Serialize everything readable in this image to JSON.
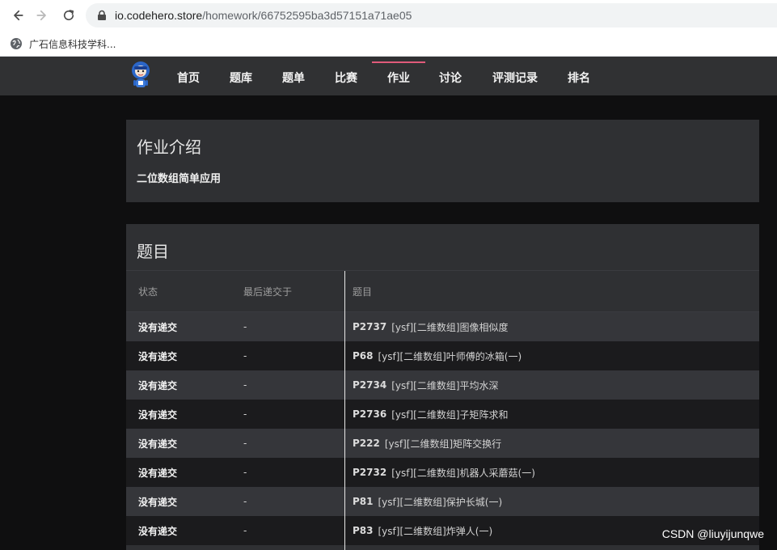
{
  "browser": {
    "url_domain": "io.codehero.store",
    "url_path": "/homework/66752595ba3d57151a71ae05",
    "bookmark_label": "广石信息科技学科..."
  },
  "site_nav": {
    "items": [
      "首页",
      "题库",
      "题单",
      "比赛",
      "作业",
      "讨论",
      "评测记录",
      "排名"
    ],
    "active": "作业"
  },
  "intro": {
    "title": "作业介绍",
    "text": "二位数组简单应用"
  },
  "problems": {
    "title": "题目",
    "columns": [
      "状态",
      "最后递交于",
      "题目"
    ],
    "rows": [
      {
        "status": "没有递交",
        "last": "-",
        "id": "P2737",
        "name": "[ysf][二维数组]图像相似度"
      },
      {
        "status": "没有递交",
        "last": "-",
        "id": "P68",
        "name": "[ysf][二维数组]叶师傅的冰箱(一)"
      },
      {
        "status": "没有递交",
        "last": "-",
        "id": "P2734",
        "name": "[ysf][二维数组]平均水深"
      },
      {
        "status": "没有递交",
        "last": "-",
        "id": "P2736",
        "name": "[ysf][二维数组]子矩阵求和"
      },
      {
        "status": "没有递交",
        "last": "-",
        "id": "P222",
        "name": "[ysf][二维数组]矩阵交换行"
      },
      {
        "status": "没有递交",
        "last": "-",
        "id": "P2732",
        "name": "[ysf][二维数组]机器人采蘑菇(一)"
      },
      {
        "status": "没有递交",
        "last": "-",
        "id": "P81",
        "name": "[ysf][二维数组]保护长城(一)"
      },
      {
        "status": "没有递交",
        "last": "-",
        "id": "P83",
        "name": "[ysf][二维数组]炸弹人(一)"
      }
    ]
  },
  "watermark": "CSDN @liuyijunqwe",
  "icons": {
    "back": "back-arrow-icon",
    "forward": "forward-arrow-icon",
    "reload": "reload-icon",
    "lock": "lock-icon",
    "globe": "globe-icon",
    "logo": "codehero-logo-icon"
  },
  "colors": {
    "page_bg": "#0f0f10",
    "nav_bg": "#303133",
    "card_bg": "#2f3033",
    "active_accent": "#e05a7a",
    "row_odd": "#35363a",
    "row_even": "#1b1b1d"
  }
}
